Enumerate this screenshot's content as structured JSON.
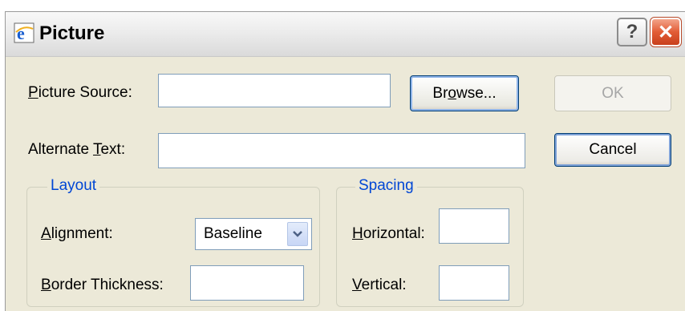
{
  "dialog": {
    "title": "Picture",
    "help_label": "?",
    "close_label": "✕",
    "icon": "ie-logo-icon"
  },
  "fields": {
    "picture_source": {
      "label_accel": "P",
      "label_rest": "icture Source:",
      "value": ""
    },
    "alternate_text": {
      "label_pre": "Alternate ",
      "label_accel": "T",
      "label_rest": "ext:",
      "value": ""
    }
  },
  "buttons": {
    "browse": {
      "pre": "Br",
      "accel": "o",
      "rest": "wse..."
    },
    "ok": "OK",
    "cancel": "Cancel"
  },
  "layout_group": {
    "title": "Layout",
    "alignment": {
      "label_accel": "A",
      "label_rest": "lignment:",
      "value": "Baseline"
    },
    "border_thickness": {
      "label_accel": "B",
      "label_rest": "order Thickness:",
      "value": ""
    }
  },
  "spacing_group": {
    "title": "Spacing",
    "horizontal": {
      "label_accel": "H",
      "label_rest": "orizontal:",
      "value": ""
    },
    "vertical": {
      "label_accel": "V",
      "label_rest": "ertical:",
      "value": ""
    }
  },
  "colors": {
    "dialog_bg": "#ece9d8",
    "group_title": "#0046d5",
    "close_red": "#e25c36",
    "field_border": "#7f9db9"
  }
}
